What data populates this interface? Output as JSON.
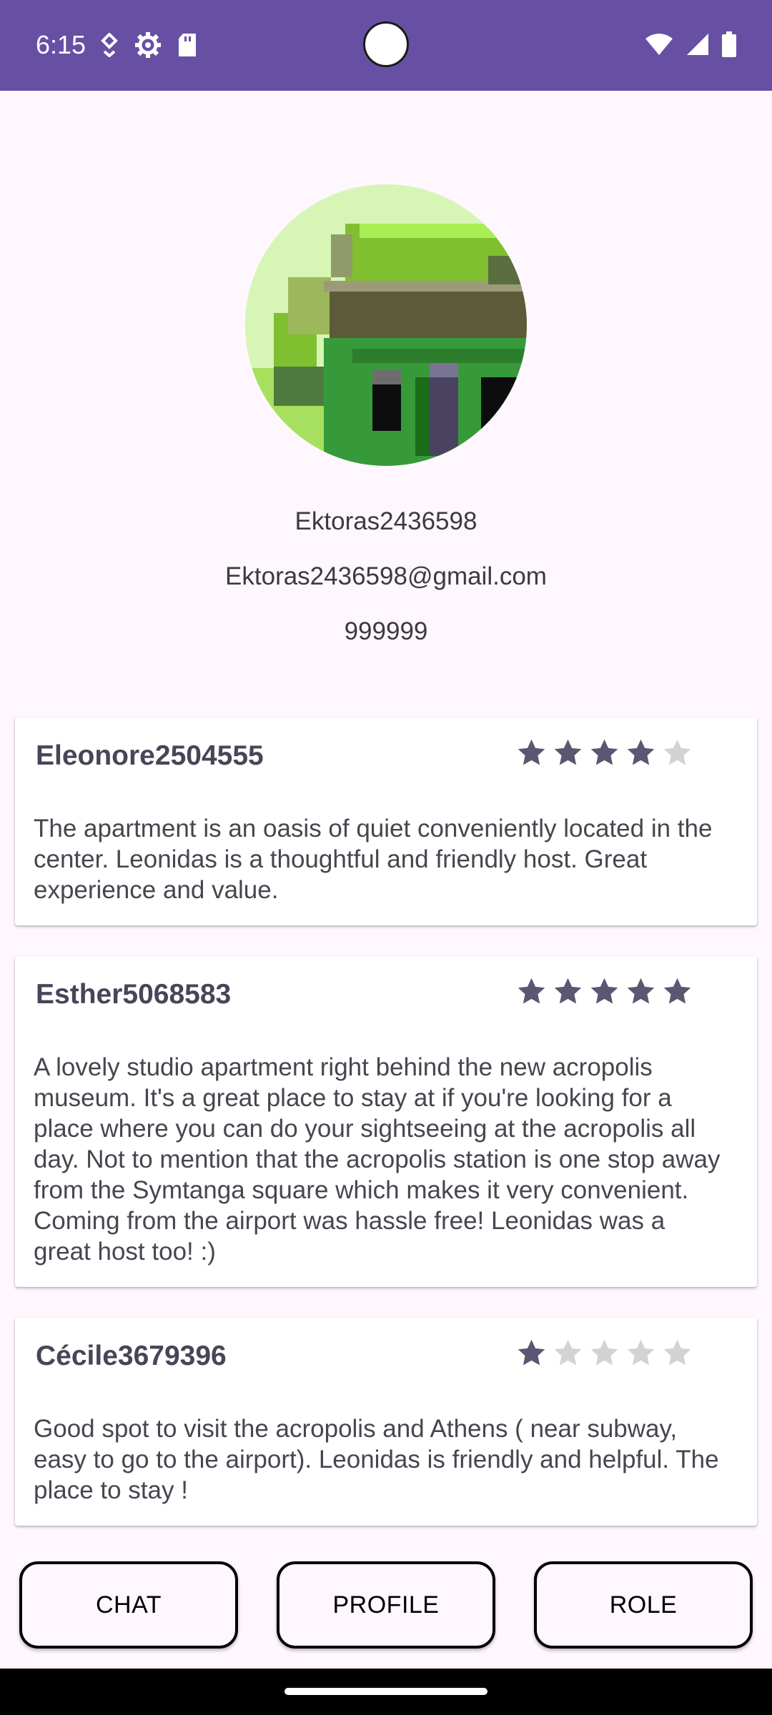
{
  "status_bar": {
    "time": "6:15",
    "background": "#6750a4",
    "icons_left": [
      "location-icon",
      "settings-icon",
      "sd-card-icon"
    ],
    "icons_right": [
      "wifi-icon",
      "signal-icon",
      "battery-icon"
    ]
  },
  "profile": {
    "username": "Ektoras2436598",
    "email": "Ektoras2436598@gmail.com",
    "phone": "999999",
    "avatar": "pixel-art-house-avatar"
  },
  "reviews": [
    {
      "user": "Eleonore2504555",
      "rating": 4,
      "max_rating": 5,
      "text": "The apartment is an oasis of quiet conveniently located in the center. Leonidas is a thoughtful and friendly host. Great experience and value."
    },
    {
      "user": "Esther5068583",
      "rating": 5,
      "max_rating": 5,
      "text": "A lovely studio apartment right behind the new acropolis museum. It's a great place to stay at if you're looking for a place where you can do your sightseeing at the acropolis all day. Not to mention that the acropolis station is one stop away from the Symtanga square which makes it very convenient. Coming from the airport was hassle free! Leonidas was a great host too! :)"
    },
    {
      "user": "Cécile3679396",
      "rating": 1,
      "max_rating": 5,
      "text": "Good spot to visit the acropolis and Athens ( near subway, easy to go to the airport). Leonidas is friendly and helpful. The place to stay !"
    }
  ],
  "buttons": {
    "chat": "CHAT",
    "profile": "PROFILE",
    "role": "ROLE"
  },
  "colors": {
    "star_filled": "#5b5671",
    "star_empty": "#d3d3d6"
  }
}
